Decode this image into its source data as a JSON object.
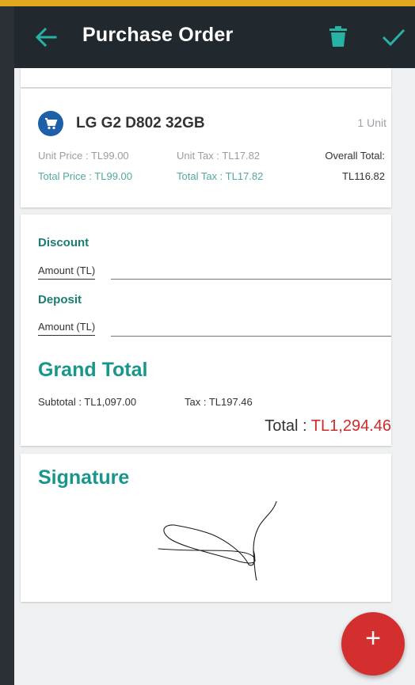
{
  "toolbar": {
    "title": "Purchase Order",
    "back_icon": "arrow-left-icon",
    "delete_icon": "trash-icon",
    "confirm_icon": "check-icon"
  },
  "item": {
    "name": "LG G2 D802 32GB",
    "quantity": "1 Unit",
    "unit_price": "Unit Price : TL99.00",
    "unit_tax": "Unit Tax : TL17.82",
    "overall_total_label": "Overall Total:",
    "total_price": "Total Price : TL99.00",
    "total_tax": "Total Tax : TL17.82",
    "overall_total_value": "TL116.82",
    "icon": "shopping-cart-icon"
  },
  "discount": {
    "label": "Discount",
    "amount_label": "Amount (TL)",
    "value": ""
  },
  "deposit": {
    "label": "Deposit",
    "amount_label": "Amount (TL)",
    "value": ""
  },
  "grand_total": {
    "title": "Grand Total",
    "subtotal": "Subtotal : TL1,097.00",
    "tax": "Tax : TL197.46",
    "total_label": "Total : ",
    "total_value": "TL1,294.46"
  },
  "signature": {
    "title": "Signature"
  },
  "fab": {
    "label": "+"
  },
  "colors": {
    "accent": "#19968a",
    "toolbar": "#21292f",
    "fab": "#d32f2f",
    "total_amount": "#cf2a2a",
    "status_bar": "#e0a81c"
  }
}
